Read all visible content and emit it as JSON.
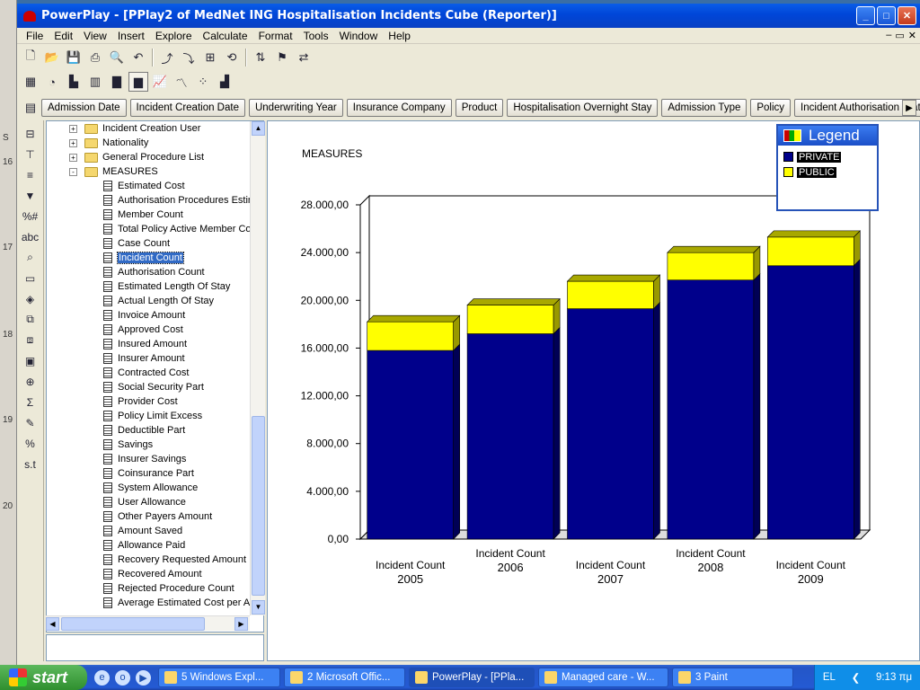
{
  "window": {
    "title": "PowerPlay - [PPlay2 of MedNet ING Hospitalisation Incidents Cube (Reporter)]"
  },
  "left_strip_numbers": [
    "S",
    "16",
    "17",
    "18",
    "19",
    "20"
  ],
  "menu": [
    "File",
    "Edit",
    "View",
    "Insert",
    "Explore",
    "Calculate",
    "Format",
    "Tools",
    "Window",
    "Help"
  ],
  "dimensions": [
    "Admission Date",
    "Incident Creation Date",
    "Underwriting Year",
    "Insurance Company",
    "Product",
    "Hospitalisation Overnight Stay",
    "Admission Type",
    "Policy",
    "Incident Authorisation Status"
  ],
  "tree": {
    "folders": [
      {
        "label": "Incident Creation User",
        "expander": "+"
      },
      {
        "label": "Nationality",
        "expander": "+"
      },
      {
        "label": "General Procedure List",
        "expander": "+"
      },
      {
        "label": "MEASURES",
        "expander": "-"
      }
    ],
    "measures": [
      "Estimated Cost",
      "Authorisation Procedures Estim",
      "Member Count",
      "Total Policy Active Member Co",
      "Case Count",
      "Incident Count",
      "Authorisation Count",
      "Estimated Length Of Stay",
      "Actual Length Of Stay",
      "Invoice Amount",
      "Approved Cost",
      "Insured Amount",
      "Insurer Amount",
      "Contracted Cost",
      "Social Security Part",
      "Provider Cost",
      "Policy Limit Excess",
      "Deductible Part",
      "Savings",
      "Insurer Savings",
      "Coinsurance Part",
      "System Allowance",
      "User Allowance",
      "Other Payers Amount",
      "Amount Saved",
      "Allowance Paid",
      "Recovery Requested Amount",
      "Recovered Amount",
      "Rejected Procedure Count",
      "Average Estimated Cost per A"
    ],
    "selected": "Incident Count"
  },
  "legend": {
    "title": "Legend",
    "items": [
      {
        "label": "PRIVATE",
        "color": "#00008b"
      },
      {
        "label": "PUBLIC",
        "color": "#ffff00"
      }
    ]
  },
  "chart_data": {
    "type": "bar",
    "stacked": true,
    "title": "MEASURES",
    "categories": [
      "2005",
      "2006",
      "2007",
      "2008",
      "2009"
    ],
    "category_measure": "Incident Count",
    "series": [
      {
        "name": "PRIVATE",
        "color": "#00008b",
        "values": [
          15800,
          17200,
          19300,
          21700,
          22900
        ]
      },
      {
        "name": "PUBLIC",
        "color": "#ffff00",
        "values": [
          2400,
          2400,
          2300,
          2300,
          2400
        ]
      }
    ],
    "ylim": [
      0,
      28000
    ],
    "yticks": [
      0,
      4000,
      8000,
      12000,
      16000,
      20000,
      24000,
      28000
    ],
    "ytick_labels": [
      "0,00",
      "4.000,00",
      "8.000,00",
      "12.000,00",
      "16.000,00",
      "20.000,00",
      "24.000,00",
      "28.000,00"
    ],
    "legend_position": "top-right"
  },
  "taskbar": {
    "start": "start",
    "tasks": [
      {
        "label": "5 Windows Expl...",
        "active": false
      },
      {
        "label": "2 Microsoft Offic...",
        "active": false
      },
      {
        "label": "PowerPlay - [PPla...",
        "active": true
      },
      {
        "label": "Managed care - W...",
        "active": false
      },
      {
        "label": "3 Paint",
        "active": false
      }
    ],
    "lang": "EL",
    "clock": "9:13 πμ"
  }
}
